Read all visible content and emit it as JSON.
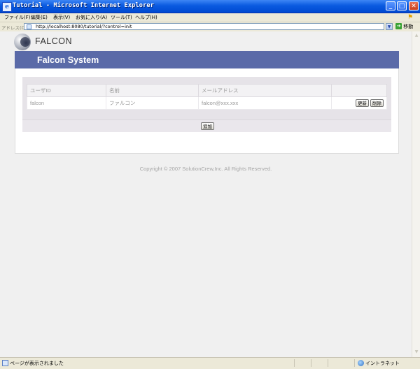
{
  "window": {
    "title": "Tutorial - Microsoft Internet Explorer",
    "minimize": "_",
    "maximize": "□",
    "close": "✕"
  },
  "menu": {
    "items": [
      "ファイル(F)",
      "編集(E)",
      "表示(V)",
      "お気に入り(A)",
      "ツール(T)",
      "ヘルプ(H)"
    ]
  },
  "address_bar": {
    "label": "アドレス(D)",
    "url": "http://localhost:8080/tutorial/?control=init",
    "go_label": "移動"
  },
  "page": {
    "logo_text": "FALCON",
    "header_title": "Falcon System",
    "table": {
      "columns": [
        "ユーザID",
        "名前",
        "メールアドレス",
        ""
      ],
      "rows": [
        {
          "user_id": "falcon",
          "name": "ファルコン",
          "email": "falcon@xxx.xxx",
          "update_label": "更新",
          "delete_label": "削除"
        }
      ]
    },
    "add_label": "追加",
    "copyright": "Copyright © 2007 SolutionCrew,Inc. All Rights Reserved."
  },
  "status_bar": {
    "text": "ページが表示されました",
    "zone": "イントラネット"
  },
  "colors": {
    "title_bar": "#0a5ae0",
    "header_band": "#5a6aa8",
    "page_background": "#f0f0f0"
  }
}
